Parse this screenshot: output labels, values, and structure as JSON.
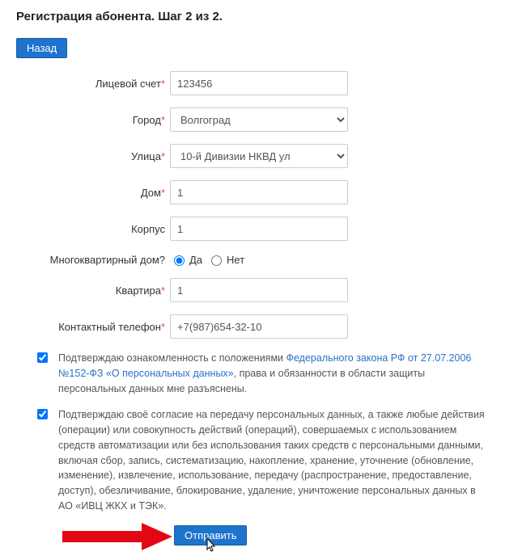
{
  "title": "Регистрация абонента. Шаг 2 из 2.",
  "buttons": {
    "back": "Назад",
    "submit": "Отправить"
  },
  "labels": {
    "account": "Лицевой счет",
    "city": "Город",
    "street": "Улица",
    "house": "Дом",
    "building": "Корпус",
    "multiApartment": "Многоквартирный дом?",
    "flat": "Квартира",
    "phone": "Контактный телефон"
  },
  "values": {
    "account": "123456",
    "city": "Волгоград",
    "street": "10-й Дивизии НКВД ул",
    "house": "1",
    "building": "1",
    "flat": "1",
    "phone": "+7(987)654-32-10"
  },
  "radios": {
    "yes": "Да",
    "no": "Нет"
  },
  "consent1": {
    "prefix": "Подтверждаю ознакомленность с положениями ",
    "link": "Федерального закона РФ от 27.07.2006 №152-ФЗ «О персональных данных»",
    "suffix": ", права и обязанности в области защиты персональных данных мне разъяснены."
  },
  "consent2": "Подтверждаю своё согласие на передачу персональных данных, а также любые действия (операции) или совокупность действий (операций), совершаемых с использованием средств автоматизации или без использования таких средств с персональными данными, включая сбор, запись, систематизацию, накопление, хранение, уточнение (обновление, изменение), извлечение, использование, передачу (распространение, предоставление, доступ), обезличивание, блокирование, удаление, уничтожение персональных данных в АО «ИВЦ ЖКХ и ТЭК»."
}
